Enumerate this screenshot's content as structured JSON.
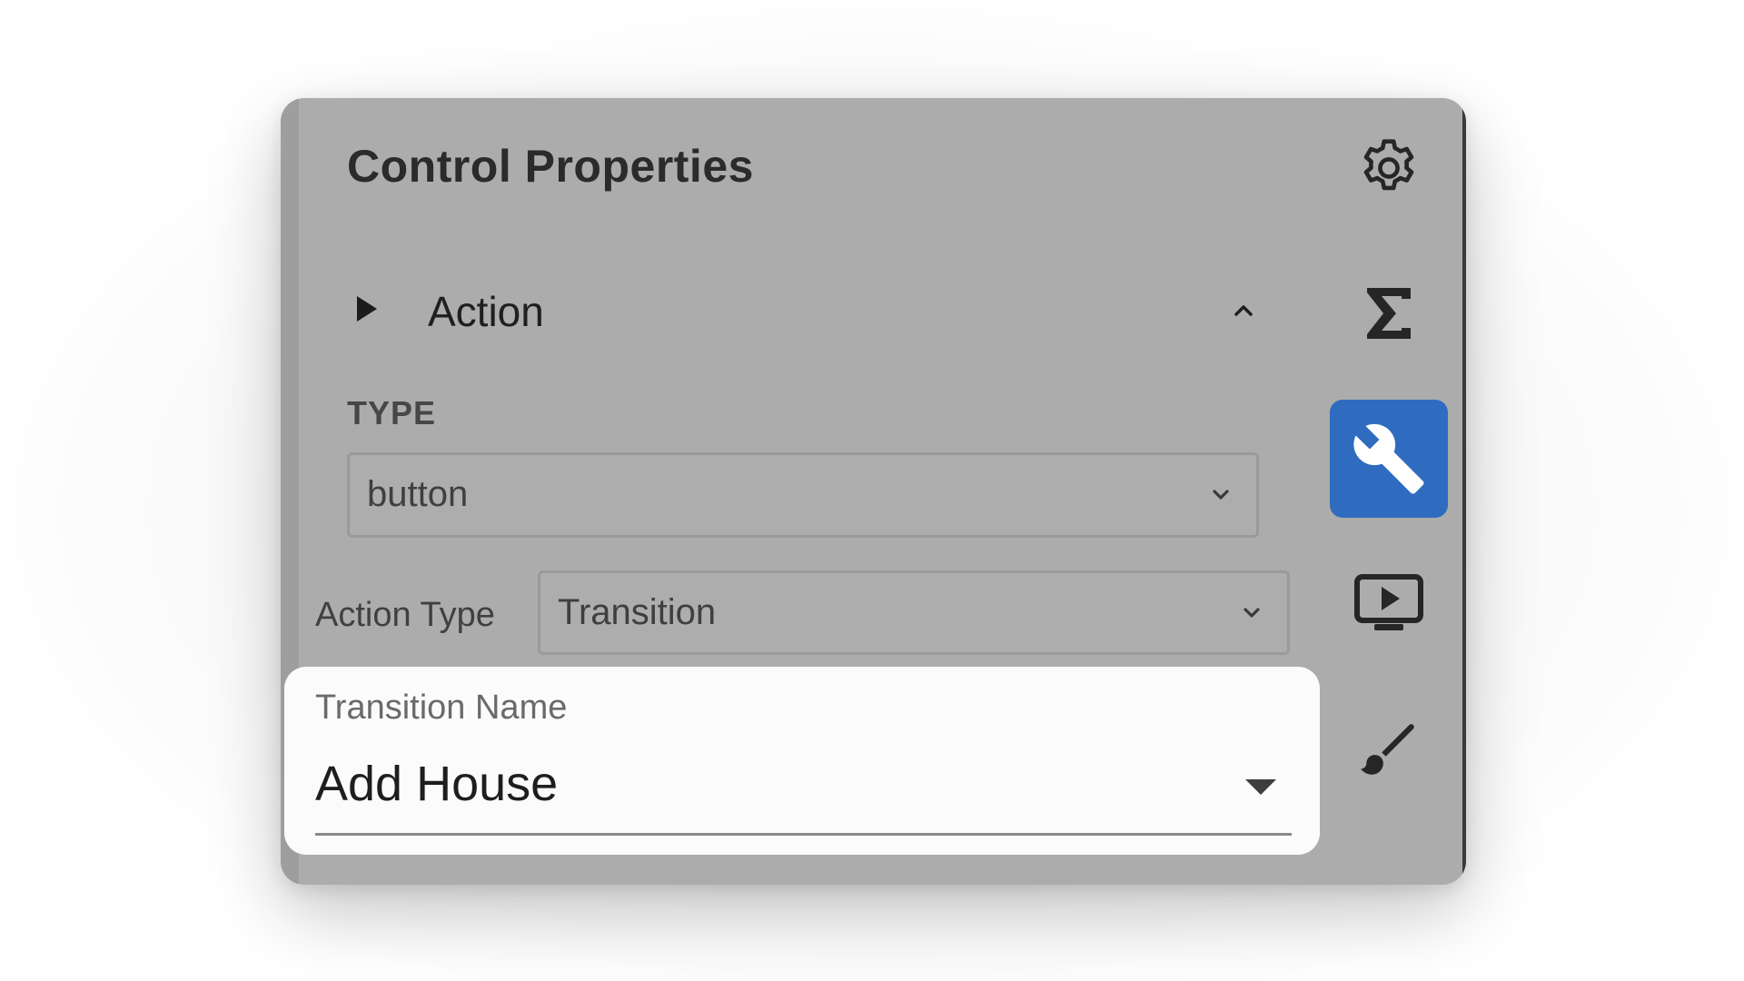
{
  "panel": {
    "title": "Control Properties"
  },
  "section": {
    "label": "Action",
    "triangle_icon": "play-triangle-icon",
    "collapse_icon": "chevron-up-icon"
  },
  "type_field": {
    "label": "TYPE",
    "value": "button"
  },
  "action_type_field": {
    "label": "Action Type",
    "value": "Transition"
  },
  "transition_field": {
    "label": "Transition Name",
    "value": "Add House"
  },
  "sidebar": {
    "items": [
      {
        "icon": "gear-icon",
        "active": false
      },
      {
        "icon": "sigma-icon",
        "active": false
      },
      {
        "icon": "wrench-icon",
        "active": true
      },
      {
        "icon": "monitor-play-icon",
        "active": false
      },
      {
        "icon": "paint-brush-icon",
        "active": false
      }
    ]
  },
  "colors": {
    "panel_background": "#acacac",
    "active_accent": "#2f6cbf",
    "card_background": "#fbfbfb"
  }
}
